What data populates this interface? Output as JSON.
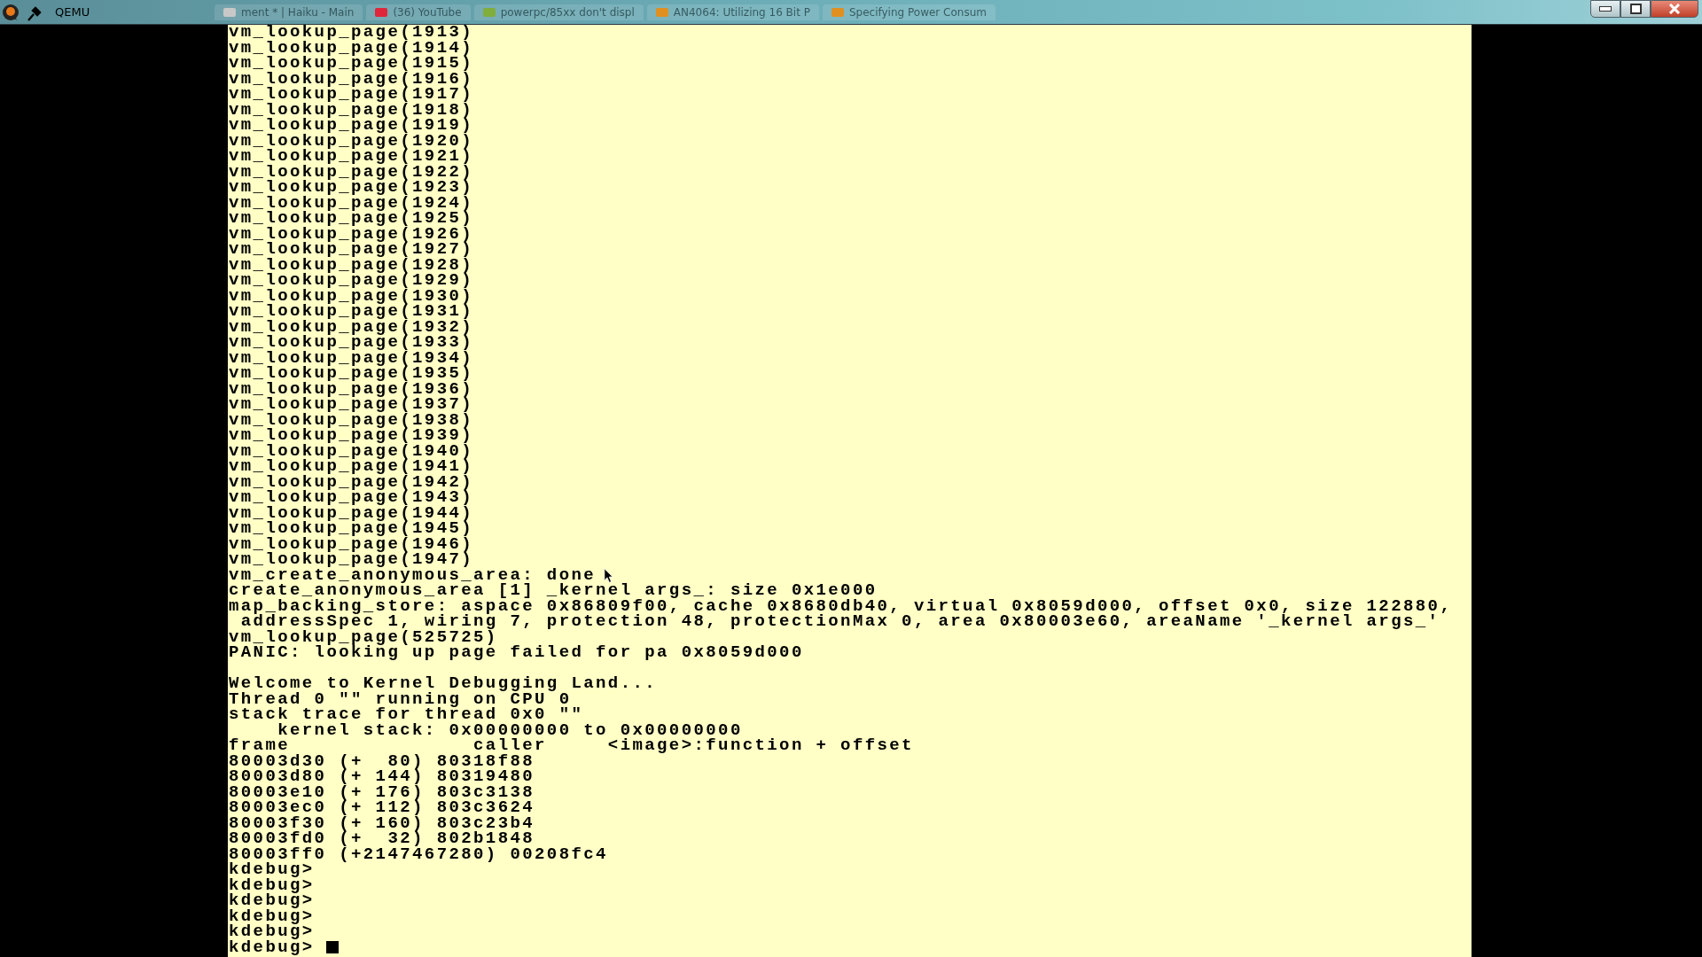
{
  "window": {
    "title": "QEMU"
  },
  "background_tabs": [
    {
      "label": "ment * | Haiku - Main",
      "color": "#c8c8c8"
    },
    {
      "label": "(36) YouTube",
      "color": "#e0263a"
    },
    {
      "label": "powerpc/85xx don't displ",
      "color": "#7fae3c"
    },
    {
      "label": "AN4064: Utilizing 16 Bit P",
      "color": "#e09020"
    },
    {
      "label": "Specifying Power Consum",
      "color": "#e09020"
    }
  ],
  "terminal": {
    "log_lines": [
      "vm_lookup_page(1913)",
      "vm_lookup_page(1914)",
      "vm_lookup_page(1915)",
      "vm_lookup_page(1916)",
      "vm_lookup_page(1917)",
      "vm_lookup_page(1918)",
      "vm_lookup_page(1919)",
      "vm_lookup_page(1920)",
      "vm_lookup_page(1921)",
      "vm_lookup_page(1922)",
      "vm_lookup_page(1923)",
      "vm_lookup_page(1924)",
      "vm_lookup_page(1925)",
      "vm_lookup_page(1926)",
      "vm_lookup_page(1927)",
      "vm_lookup_page(1928)",
      "vm_lookup_page(1929)",
      "vm_lookup_page(1930)",
      "vm_lookup_page(1931)",
      "vm_lookup_page(1932)",
      "vm_lookup_page(1933)",
      "vm_lookup_page(1934)",
      "vm_lookup_page(1935)",
      "vm_lookup_page(1936)",
      "vm_lookup_page(1937)",
      "vm_lookup_page(1938)",
      "vm_lookup_page(1939)",
      "vm_lookup_page(1940)",
      "vm_lookup_page(1941)",
      "vm_lookup_page(1942)",
      "vm_lookup_page(1943)",
      "vm_lookup_page(1944)",
      "vm_lookup_page(1945)",
      "vm_lookup_page(1946)",
      "vm_lookup_page(1947)",
      "vm_create_anonymous_area: done",
      "create_anonymous_area [1] _kernel args_: size 0x1e000",
      "map_backing_store: aspace 0x86809f00, cache 0x8680db40, virtual 0x8059d000, offset 0x0, size 122880,",
      " addressSpec 1, wiring 7, protection 48, protectionMax 0, area 0x80003e60, areaName '_kernel args_'",
      "vm_lookup_page(525725)",
      "PANIC: looking up page failed for pa 0x8059d000"
    ],
    "debugger_lines": [
      "Welcome to Kernel Debugging Land...",
      "Thread 0 \"\" running on CPU 0",
      "stack trace for thread 0x0 \"\"",
      "    kernel stack: 0x00000000 to 0x00000000",
      "frame               caller     <image>:function + offset",
      "80003d30 (+  80) 80318f88",
      "80003d80 (+ 144) 80319480",
      "80003e10 (+ 176) 803c3138",
      "80003ec0 (+ 112) 803c3624",
      "80003f30 (+ 160) 803c23b4",
      "80003fd0 (+  32) 802b1848",
      "80003ff0 (+2147467280) 00208fc4",
      "kdebug>",
      "kdebug>",
      "kdebug>",
      "kdebug>",
      "kdebug>"
    ],
    "prompt": "kdebug> "
  }
}
